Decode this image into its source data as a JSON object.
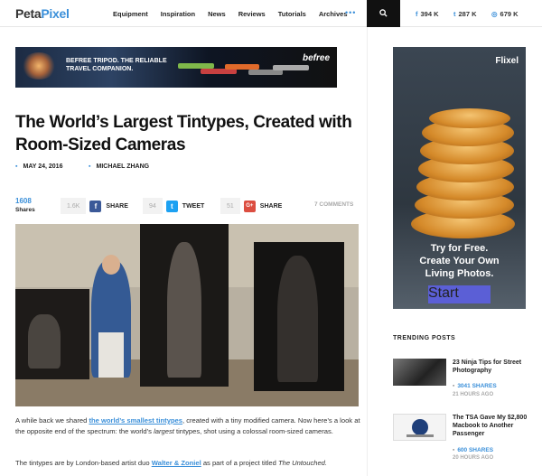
{
  "nav": {
    "logo_a": "Peta",
    "logo_b": "Pixel",
    "items": [
      "Equipment",
      "Inspiration",
      "News",
      "Reviews",
      "Tutorials",
      "Archives"
    ],
    "more": "•••",
    "social": [
      {
        "icon": "facebook-icon",
        "glyph": "f",
        "count": "394 K"
      },
      {
        "icon": "twitter-icon",
        "glyph": "t",
        "count": "287 K"
      },
      {
        "icon": "instagram-icon",
        "glyph": "◎",
        "count": "679 K"
      }
    ]
  },
  "banner": {
    "headline_1": "BEFREE TRIPOD. THE RELIABLE",
    "headline_2": "TRAVEL COMPANION.",
    "brand": "befree"
  },
  "article": {
    "title": "The World’s Largest Tintypes, Created with Room-Sized Cameras",
    "date": "MAY 24, 2016",
    "author": "MICHAEL ZHANG",
    "shares_count": "1608",
    "shares_label": "Shares",
    "share_buttons": [
      {
        "count": "1.6K",
        "glyph": "f",
        "label": "SHARE",
        "color": "#3b5998"
      },
      {
        "count": "94",
        "glyph": "t",
        "label": "TWEET",
        "color": "#1da1f2"
      },
      {
        "count": "51",
        "glyph": "G+",
        "label": "SHARE",
        "color": "#dc4e41"
      }
    ],
    "comments": "7 COMMENTS",
    "p1_a": "A while back we shared ",
    "p1_link": "the world’s smallest tintypes",
    "p1_b": ", created with a tiny modified camera. Now here’s a look at the opposite end of the spectrum: the world’s ",
    "p1_em": "largest",
    "p1_c": " tintypes, shot using a colossal room-sized cameras.",
    "p2_a": "The tintypes are by London-based artist duo ",
    "p2_link": "Walter & Zoniel",
    "p2_b": " as part of a project titled ",
    "p2_em": "The Untouched."
  },
  "ad": {
    "brand": "Flixel",
    "line1": "Try for Free.",
    "line2": "Create Your Own",
    "line3": "Living Photos.",
    "button": "Start Here"
  },
  "trending": {
    "heading": "TRENDING POSTS",
    "posts": [
      {
        "title": "23 Ninja Tips for Street Photography",
        "shares": "3041 SHARES",
        "ago": "21 HOURS AGO"
      },
      {
        "title": "The TSA Gave My $2,800 Macbook to Another Passenger",
        "shares": "600 SHARES",
        "ago": "20 HOURS AGO"
      }
    ]
  }
}
